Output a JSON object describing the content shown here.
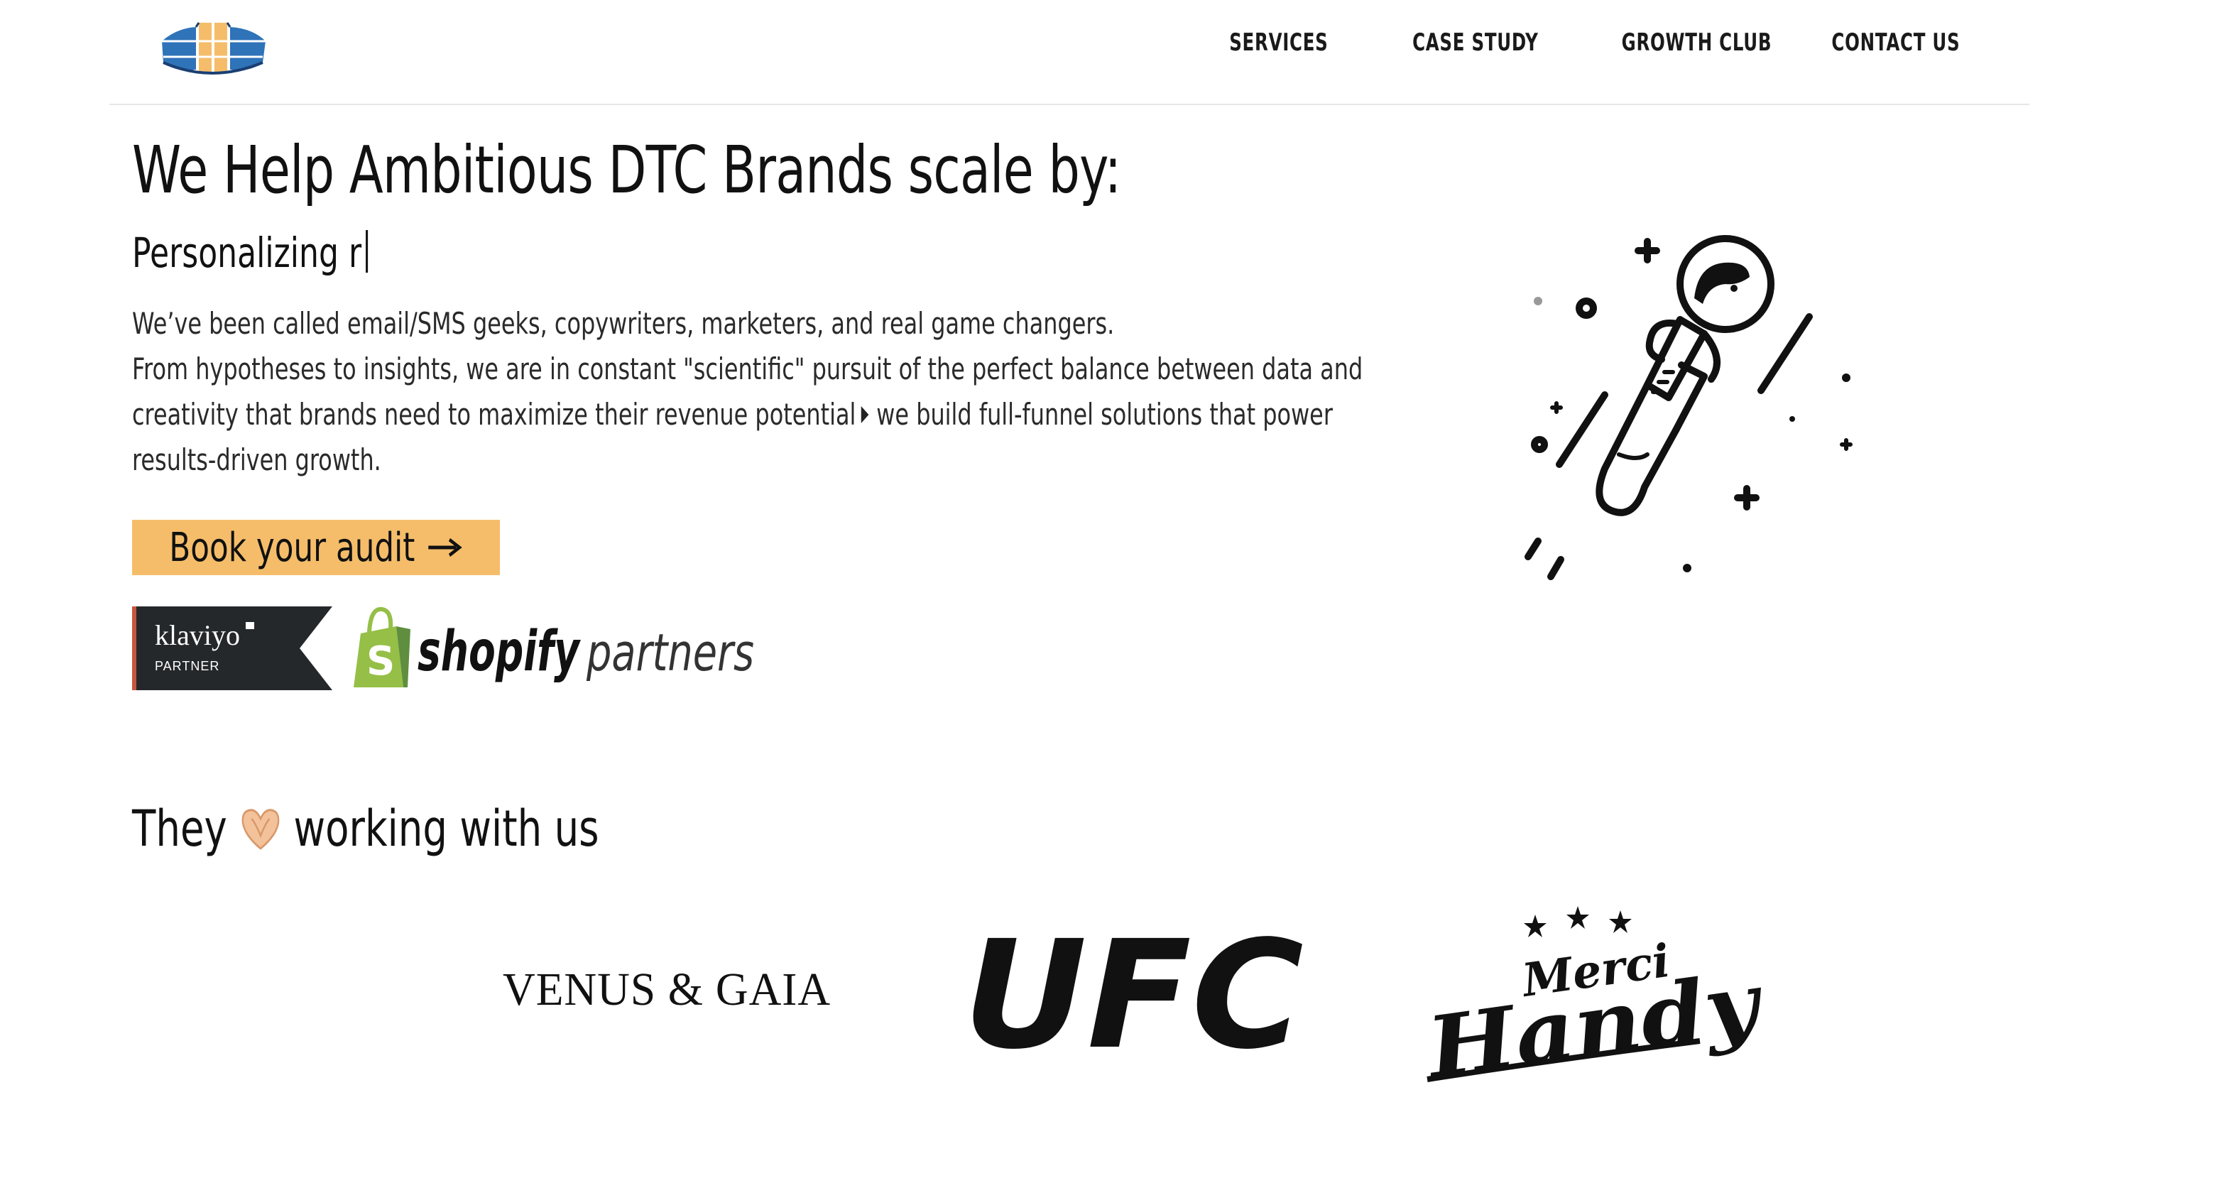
{
  "header": {
    "nav": [
      {
        "label": "SERVICES"
      },
      {
        "label": "CASE STUDY"
      },
      {
        "label": "GROWTH CLUB"
      },
      {
        "label": "CONTACT US"
      }
    ]
  },
  "hero": {
    "title": "We Help Ambitious DTC Brands scale by:",
    "typed_text": "Personalizing r",
    "description": {
      "line1": "We’ve been called email/SMS geeks, copywriters, marketers, and real game changers.",
      "line2a": "From hypotheses to insights, we are in constant \"scientific\" pursuit of the perfect balance between data and creativity that brands need to maximize their revenue potential",
      "line2b": "we build full-funnel solutions that power results-driven growth."
    },
    "cta_label": "Book your audit",
    "badges": {
      "klaviyo_name": "klaviyo",
      "klaviyo_sub": "PARTNER",
      "shopify_name": "shopify",
      "shopify_sub": "partners"
    }
  },
  "clients": {
    "title_before": "They",
    "title_after": "working with us",
    "logos": {
      "venus": "VENUS & GAIA",
      "ufc": "UFC",
      "merci_top": "Merci",
      "merci_bottom": "Handy"
    }
  },
  "colors": {
    "cta": "#f5bd6a",
    "klaviyo_bg": "#25282b",
    "shopify_green": "#95bf47",
    "logo_blue": "#2f73b9",
    "logo_orange": "#f5bd6a"
  }
}
